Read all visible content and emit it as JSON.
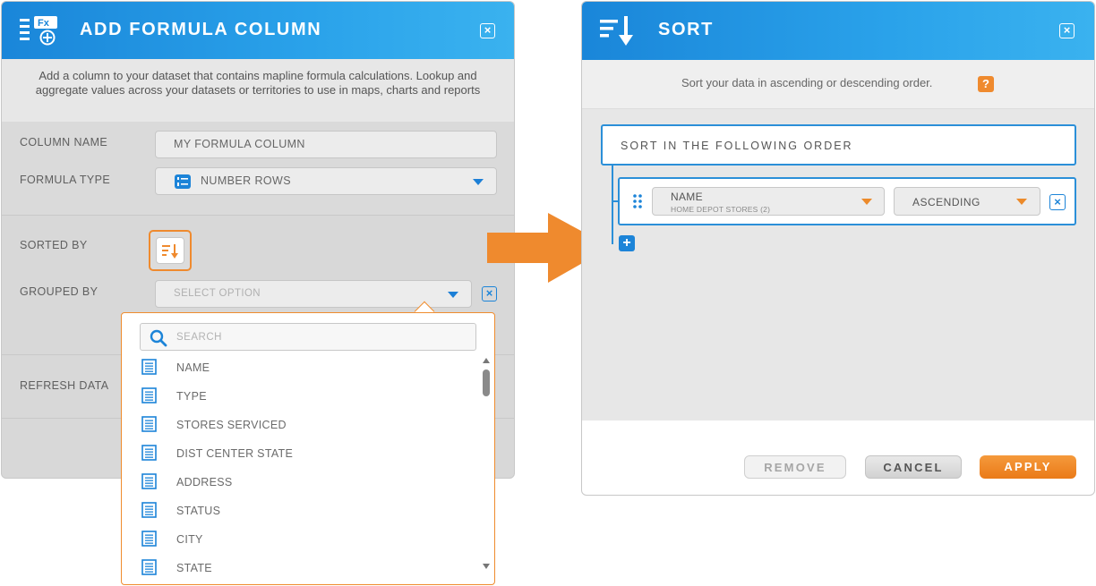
{
  "colors": {
    "accent_blue": "#1c84d8",
    "accent_orange": "#ef8a2e",
    "header_gradient_end": "#3ab2ef"
  },
  "formula_dialog": {
    "title": "ADD FORMULA COLUMN",
    "description": "Add a column to your dataset that contains mapline formula calculations. Lookup and aggregate values across your datasets or territories to use in maps, charts and reports",
    "column_name_label": "COLUMN NAME",
    "column_name_value": "MY FORMULA COLUMN",
    "formula_type_label": "FORMULA TYPE",
    "formula_type_value": "NUMBER ROWS",
    "sorted_by_label": "SORTED BY",
    "grouped_by_label": "GROUPED BY",
    "grouped_by_placeholder": "SELECT OPTION",
    "refresh_data_label": "REFRESH DATA"
  },
  "dropdown": {
    "search_placeholder": "SEARCH",
    "items": [
      "NAME",
      "TYPE",
      "STORES SERVICED",
      "DIST CENTER STATE",
      "ADDRESS",
      "STATUS",
      "CITY",
      "STATE"
    ]
  },
  "sort_dialog": {
    "title": "SORT",
    "description": "Sort your data in ascending or descending order.",
    "help_label": "?",
    "order_title": "SORT IN THE FOLLOWING ORDER",
    "row": {
      "field_name": "NAME",
      "field_source": "HOME DEPOT STORES (2)",
      "direction": "ASCENDING"
    },
    "remove_label": "REMOVE",
    "cancel_label": "CANCEL",
    "apply_label": "APPLY"
  }
}
